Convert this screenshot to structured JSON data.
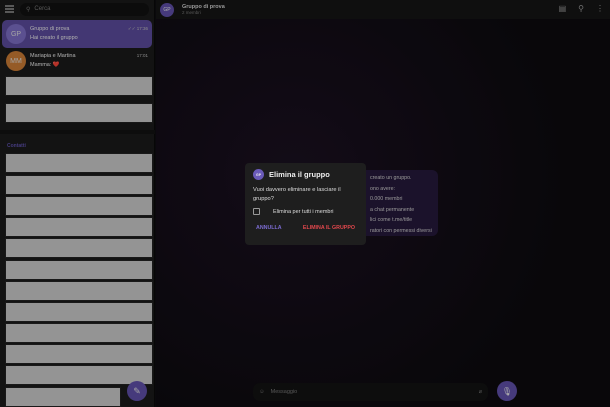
{
  "sidebar": {
    "search_placeholder": "Cerca",
    "chats": [
      {
        "initials": "GP",
        "name": "Gruppo di prova",
        "preview": "Hai creato il gruppo",
        "time": "17:36",
        "read": "✓✓"
      },
      {
        "initials": "MM",
        "name": "Mariapia e Martina",
        "preview": "Mamma: ❤️",
        "time": "17:01"
      }
    ],
    "section_label": "Contatti"
  },
  "header": {
    "initials": "GP",
    "title": "Gruppo di prova",
    "subtitle": "2 membri"
  },
  "bubble": {
    "lines": [
      "creato un gruppo.",
      "ono avere:",
      "0.000 membri",
      "a chat permanente",
      "lici come t.me/title",
      "ratori con permessi diversi"
    ]
  },
  "composer": {
    "placeholder": "Messaggio"
  },
  "dialog": {
    "initials": "GP",
    "title": "Elimina il gruppo",
    "message": "Vuoi davvero eliminare e lasciare il gruppo?",
    "checkbox_label": "Elimina per tutti i membri",
    "cancel": "ANNULLA",
    "confirm": "ELIMINA IL GRUPPO"
  },
  "colors": {
    "accent": "#5e4ea6",
    "danger": "#e0474c"
  }
}
